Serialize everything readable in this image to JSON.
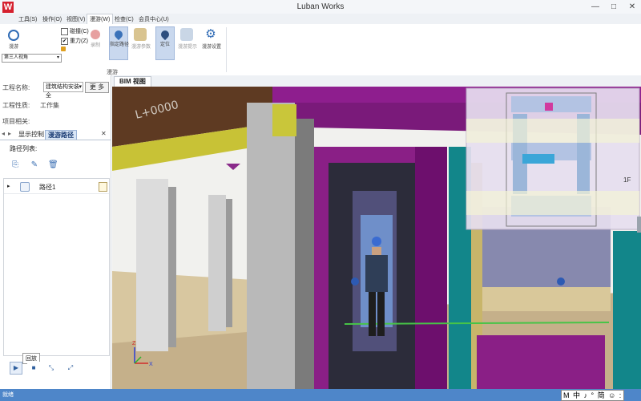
{
  "app": {
    "logo": "W",
    "title": "Luban Works",
    "minimize": "—",
    "maximize": "□",
    "close": "✕"
  },
  "menu": [
    "工具(S)",
    "操作(O)",
    "视图(V)",
    "漫游(W)",
    "检查(C)",
    "会员中心(U)"
  ],
  "ribbon": {
    "roam_btn": "漫游",
    "collision_label": "碰撞(C)",
    "collision_checked": false,
    "gravity_label": "重力(Z)",
    "gravity_checked": true,
    "view_select": "第三人视角",
    "record_btn": "录制",
    "set_path_btn": "指定路径",
    "roam_param_btn": "漫游参数",
    "locate_btn": "定位",
    "roam_tip_btn": "漫游提示",
    "roam_settings_btn": "漫游设置",
    "group_label": "漫游"
  },
  "left_panel": {
    "project_name_label": "工程名称:",
    "project_name_value": "建筑结构安装全",
    "more_btn": "更 多",
    "project_nature_label": "工程性质:",
    "project_nature_value": "工作集",
    "project_related_label": "项目相关:",
    "tabs": [
      "显示控制",
      "漫游路径"
    ],
    "path_list_title": "路径列表:",
    "paths": [
      {
        "name": "路径1"
      }
    ],
    "tooltip": "回放"
  },
  "viewport": {
    "tab": "BIM 视图",
    "floor_label": "1F",
    "axis_z": "Z",
    "axis_x": "X",
    "ceiling_text": "L+0000"
  },
  "status": {
    "text": "就绪",
    "ime": "M 中 ♪ ° 简 ☺ :"
  }
}
